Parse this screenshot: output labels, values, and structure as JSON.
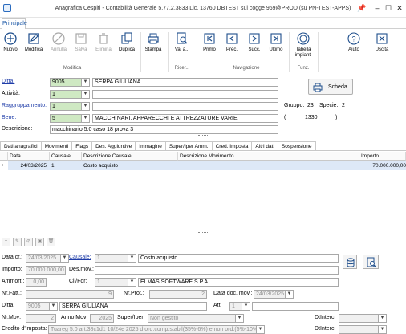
{
  "window": {
    "title": "Anagrafica Cespiti - Contabilità Generale 5.77.2.3833 Lic. 13760 DBTEST sul cogge 969@PROD (su PN-TEST-APPS)"
  },
  "tabs": {
    "principale": "Principale"
  },
  "ribbon": {
    "nuovo": "Nuovo",
    "modifica": "Modifica",
    "annulla": "Annulla",
    "salva": "Salva",
    "elimina": "Elimina",
    "duplica": "Duplica",
    "stampa": "Stampa",
    "vai_a": "Vai a...",
    "primo": "Primo",
    "prec": "Prec.",
    "succ": "Succ.",
    "ultimo": "Ultimo",
    "tabella_impianti": "Tabella impianti",
    "aiuto": "Aiuto",
    "uscita": "Uscita",
    "group_modifica": "Modifica",
    "group_ricer": "Ricer...",
    "group_navigazione": "Navigazione",
    "group_funz": "Funz."
  },
  "header": {
    "ditta_label": "Ditta:",
    "ditta_code": "9005",
    "ditta_name": "SERPA GIULIANA",
    "attivita_label": "Attività:",
    "attivita_code": "1",
    "raggruppamento_label": "Raggruppamento:",
    "raggruppamento_code": "1",
    "bene_label": "Bene:",
    "bene_code": "5",
    "bene_name": "MACCHINARI, APPARECCHI E ATTREZZATURE VARIE",
    "descrizione_label": "Descrizione:",
    "descrizione_value": "macchinario 5.0 caso 18 prova 3",
    "scheda_button": "Scheda",
    "gruppo_label": "Gruppo:",
    "gruppo_value": "23",
    "specie_label": "Specie:",
    "specie_value": "2",
    "paren_open": "(",
    "code_1330": "1330",
    "paren_close": ")"
  },
  "detail_tabs": [
    "Dati anagrafici",
    "Movimenti",
    "Flags",
    "Des. Aggiuntive",
    "Immagine",
    "Super/Iper Amm.",
    "Cred. Imposta",
    "Altri dati",
    "Sospensione"
  ],
  "grid": {
    "columns": [
      "Data",
      "Causale",
      "Descrizione Causale",
      "Descrizione Movimento",
      "Importo"
    ],
    "rows": [
      {
        "marker": "▸",
        "data": "24/03/2025",
        "causale": "1",
        "descr_causale": "Costo acquisto",
        "descr_movimento": "",
        "importo": "70.000.000,00"
      }
    ]
  },
  "form": {
    "data_cr_label": "Data cr.:",
    "data_cr_value": "24/03/2025",
    "causale_label": "Causale:",
    "causale_code": "1",
    "causale_name": "Costo acquisto",
    "importo_label": "Importo:",
    "importo_value": "70.000.000,00",
    "des_mov_label": "Des.mov.:",
    "ammort_label": "Ammort.:",
    "ammort_value": "0,00",
    "clifor_label": "Cli/For:",
    "clifor_code": "1",
    "clifor_name": "ELMAS SOFTWARE S.P.A.",
    "nr_fatt_label": "Nr.Fatt.:",
    "nr_fatt_value": "9",
    "nr_prot_label": "Nr.Prot.:",
    "nr_prot_value": "2",
    "data_doc_label": "Data doc. mov.:",
    "data_doc_value": "24/03/2025",
    "ditta_label": "Ditta:",
    "ditta_code": "9005",
    "ditta_name": "SERPA GIULIANA",
    "att_label": "Att.",
    "att_value": "1",
    "nr_mov_label": "Nr.Mov:",
    "nr_mov_value": "2",
    "anno_mov_label": "Anno Mov:",
    "anno_mov_value": "2025",
    "super_iper_label": "Super/Iper:",
    "super_iper_value": "Non gestito",
    "dtinterc_label": "DtInterc:",
    "credito_label": "Credito d'Imposta:",
    "credito_value": "Tuareg 5.0 art.38c1d1 10/24e 2025 d.ord.comp.stabil(35%-6%) e non ord.(5%-10%)",
    "dtinterc2_label": "DtInterc:"
  }
}
